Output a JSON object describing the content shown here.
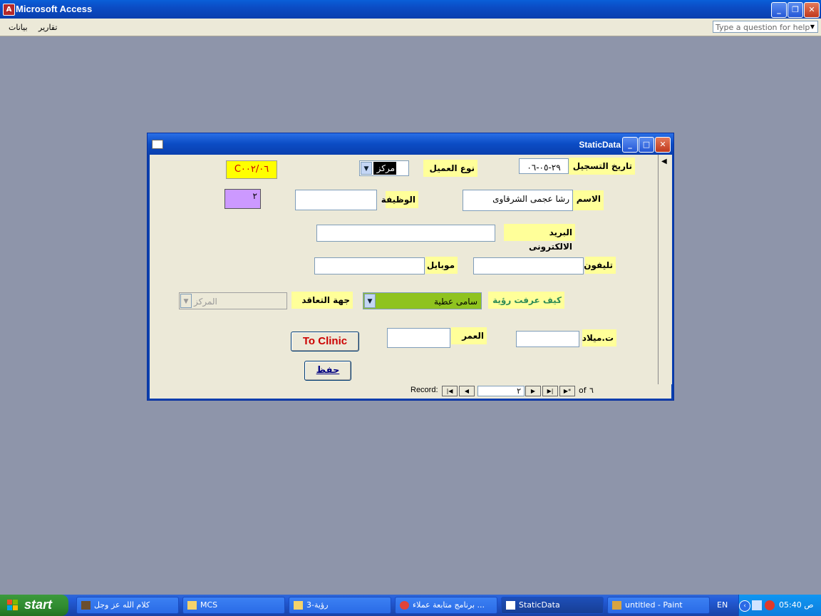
{
  "app": {
    "title": "Microsoft Access"
  },
  "menu": {
    "items": [
      "بيانات",
      "تقارير"
    ],
    "help_placeholder": "Type a question for help"
  },
  "form": {
    "title": "StaticData",
    "fields": {
      "reg_date_label": "تاريخ التسجيل",
      "reg_date_value": "٢٩-٠٥-٠٦",
      "client_type_label": "نوع العميل",
      "client_type_value": "مركز",
      "code_value": "C٠٠٢/٠٦",
      "name_label": "الاسم",
      "name_value": "رشا عجمى الشرقاوى",
      "job_label": "الوظيفة",
      "job_value": "",
      "id_value": "٢",
      "email_label": "البريد الالكترونى",
      "email_value": "",
      "phone_label": "تليفون",
      "phone_value": "",
      "mobile_label": "موبايل",
      "mobile_value": "",
      "how_known_label": "كيف عرفت رؤية",
      "how_known_value": "سامى عطية",
      "contract_label": "جهة التعاقد",
      "contract_value": "المركز",
      "birth_label": "ت.ميلاد",
      "birth_value": "",
      "age_label": "العمر",
      "age_value": ""
    },
    "buttons": {
      "to_clinic": "To Clinic",
      "save": "حفظ"
    },
    "nav": {
      "record_label": "Record:",
      "current": "٢",
      "of_label": "of",
      "total": "٦"
    }
  },
  "taskbar": {
    "start": "start",
    "tasks": [
      {
        "label": "كلام الله عز وجل"
      },
      {
        "label": "MCS"
      },
      {
        "label": "رؤية-3"
      },
      {
        "label": "برنامج متابعة عملاء ..."
      },
      {
        "label": "StaticData"
      },
      {
        "label": "untitled - Paint"
      }
    ],
    "lang": "EN",
    "clock": "05:40 ص"
  },
  "colors": {
    "label_bg": "#ffff99",
    "code_bg": "#ffff00",
    "id_bg": "#cc99ff",
    "combo_green": "#8fc31f",
    "to_clinic_text": "#cc0000"
  }
}
